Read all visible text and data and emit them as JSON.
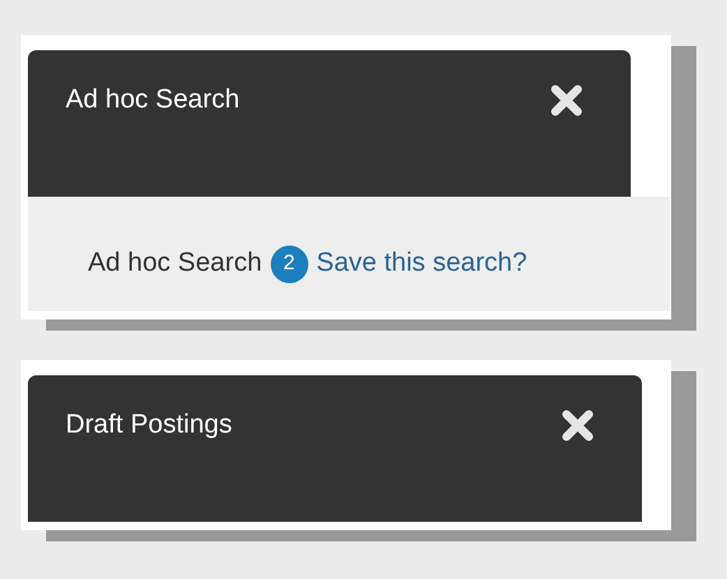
{
  "panels": [
    {
      "title": "Ad hoc Search",
      "footer": {
        "label": "Ad hoc Search",
        "count": "2",
        "link": "Save this search?"
      }
    },
    {
      "title": "Draft Postings"
    }
  ]
}
